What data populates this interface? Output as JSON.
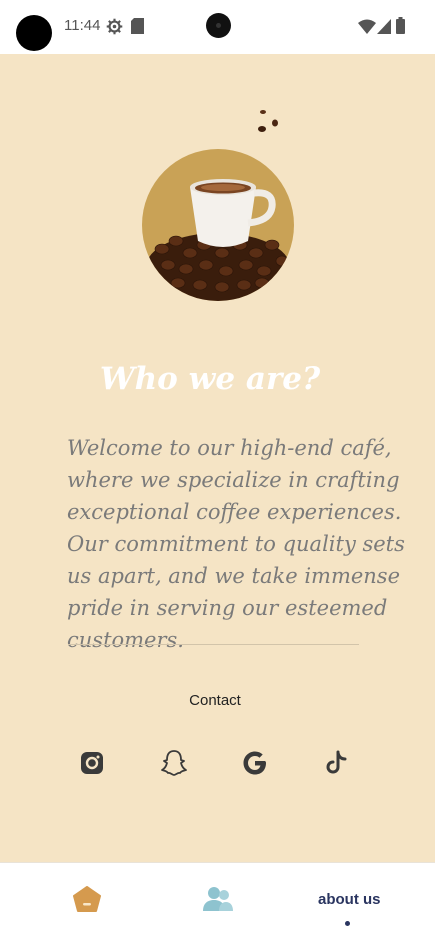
{
  "status_bar": {
    "time": "11:44",
    "icons": [
      "settings-gear-icon",
      "sd-card-icon",
      "wifi-icon",
      "cellular-signal-icon",
      "battery-icon"
    ]
  },
  "hero": {
    "image": "coffee-cup-on-beans-image",
    "title": "Who we are?"
  },
  "about": {
    "paragraph": "Welcome to our high-end café, where we specialize in crafting exceptional coffee experiences. Our commitment to quality sets us apart, and we take immense pride in serving our esteemed customers."
  },
  "contact": {
    "label": "Contact",
    "social": [
      "instagram-icon",
      "snapchat-icon",
      "google-icon",
      "tiktok-icon"
    ]
  },
  "bottom_nav": {
    "items": [
      {
        "icon": "home-icon",
        "active": false
      },
      {
        "icon": "people-icon",
        "active": false
      },
      {
        "label": "about us",
        "active": true
      }
    ]
  },
  "colors": {
    "background": "#f5e4c5",
    "title": "#ffffff",
    "paragraph": "#7a7a7a",
    "nav_active": "#2a3560",
    "home_icon": "#d59a4e",
    "people_icon": "#8ec3cf"
  }
}
